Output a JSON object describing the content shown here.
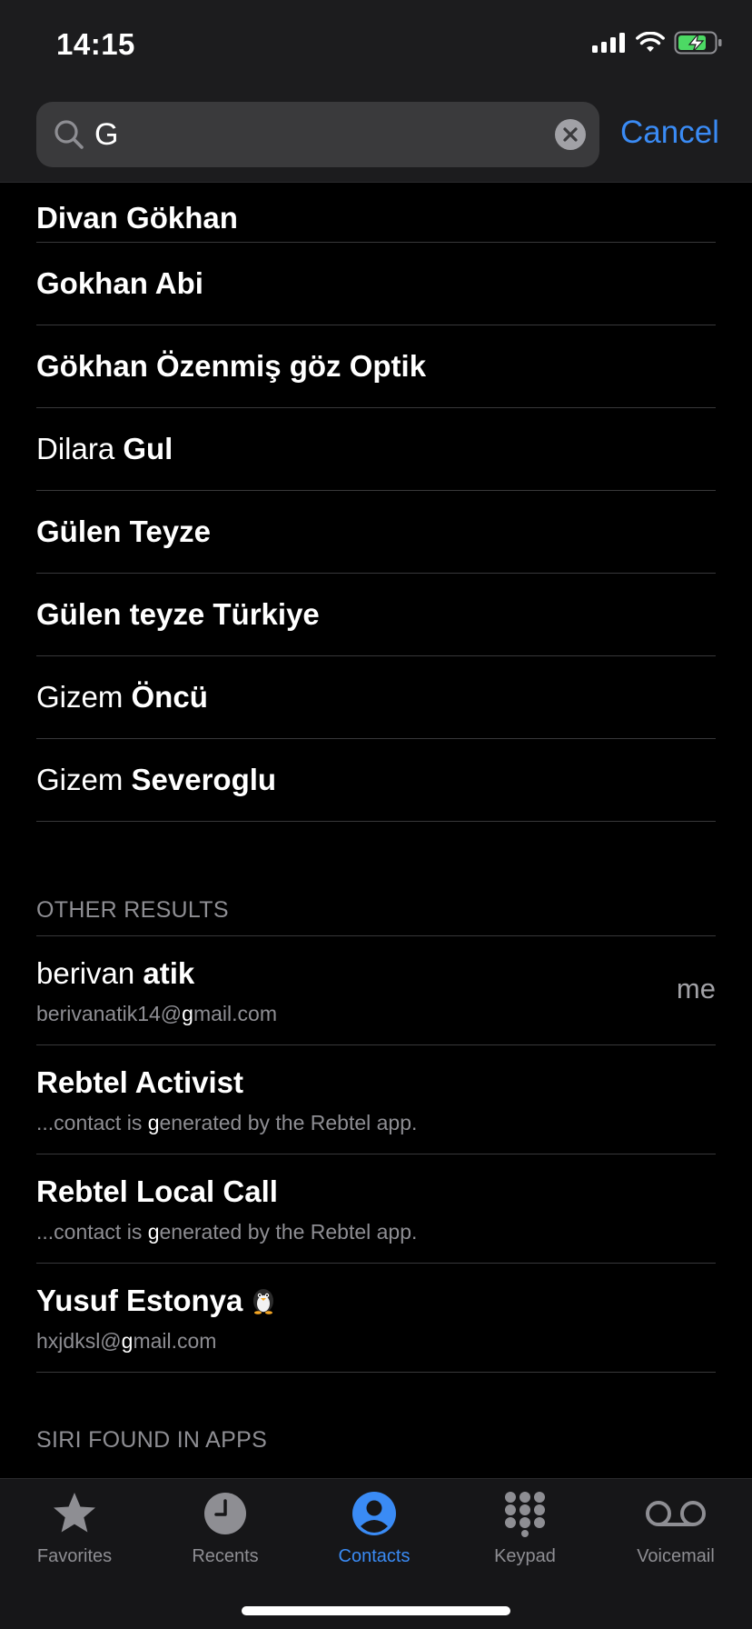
{
  "status_bar": {
    "time": "14:15"
  },
  "search": {
    "value": "G",
    "cancel_label": "Cancel"
  },
  "contacts": [
    {
      "parts": [
        {
          "t": "Divan Gökhan",
          "bold": true
        }
      ]
    },
    {
      "parts": [
        {
          "t": "Gokhan Abi",
          "bold": true
        }
      ]
    },
    {
      "parts": [
        {
          "t": "Gökhan Özenmiş göz Optik",
          "bold": true
        }
      ]
    },
    {
      "parts": [
        {
          "t": "Dilara ",
          "bold": false
        },
        {
          "t": "Gul",
          "bold": true
        }
      ]
    },
    {
      "parts": [
        {
          "t": "Gülen Teyze",
          "bold": true
        }
      ]
    },
    {
      "parts": [
        {
          "t": "Gülen teyze Türkiye",
          "bold": true
        }
      ]
    },
    {
      "parts": [
        {
          "t": "Gizem ",
          "bold": false
        },
        {
          "t": "Öncü",
          "bold": true
        }
      ]
    },
    {
      "parts": [
        {
          "t": "Gizem ",
          "bold": false
        },
        {
          "t": "Severoglu",
          "bold": true
        }
      ]
    }
  ],
  "other_results": {
    "header": "OTHER RESULTS",
    "items": [
      {
        "name_parts": [
          {
            "t": "berivan ",
            "bold": false
          },
          {
            "t": "atik",
            "bold": true
          }
        ],
        "sub_parts": [
          {
            "t": "berivanatik14@",
            "hl": false
          },
          {
            "t": "g",
            "hl": true
          },
          {
            "t": "mail.com",
            "hl": false
          }
        ],
        "me": "me"
      },
      {
        "name_parts": [
          {
            "t": "Rebtel Activist",
            "bold": true
          }
        ],
        "sub_parts": [
          {
            "t": "...contact is ",
            "hl": false
          },
          {
            "t": "g",
            "hl": true
          },
          {
            "t": "enerated by the Rebtel app.",
            "hl": false
          }
        ]
      },
      {
        "name_parts": [
          {
            "t": "Rebtel Local Call",
            "bold": true
          }
        ],
        "sub_parts": [
          {
            "t": "...contact is ",
            "hl": false
          },
          {
            "t": "g",
            "hl": true
          },
          {
            "t": "enerated by the Rebtel app.",
            "hl": false
          }
        ]
      },
      {
        "name_parts": [
          {
            "t": "Yusuf Estonya",
            "bold": true
          }
        ],
        "emoji": "penguin-emoji",
        "sub_parts": [
          {
            "t": "hxjdksl@",
            "hl": false
          },
          {
            "t": "g",
            "hl": true
          },
          {
            "t": "mail.com",
            "hl": false
          }
        ]
      }
    ]
  },
  "siri_section": {
    "header": "SIRI FOUND IN APPS"
  },
  "tab_bar": {
    "tabs": [
      {
        "label": "Favorites",
        "icon": "star-icon",
        "active": false
      },
      {
        "label": "Recents",
        "icon": "clock-icon",
        "active": false
      },
      {
        "label": "Contacts",
        "icon": "person-circle-icon",
        "active": true
      },
      {
        "label": "Keypad",
        "icon": "keypad-icon",
        "active": false
      },
      {
        "label": "Voicemail",
        "icon": "voicemail-icon",
        "active": false
      }
    ]
  },
  "colors": {
    "accent": "#3a8bf5",
    "battery_fill": "#4cd964",
    "secondary_text": "#8e8e93"
  }
}
